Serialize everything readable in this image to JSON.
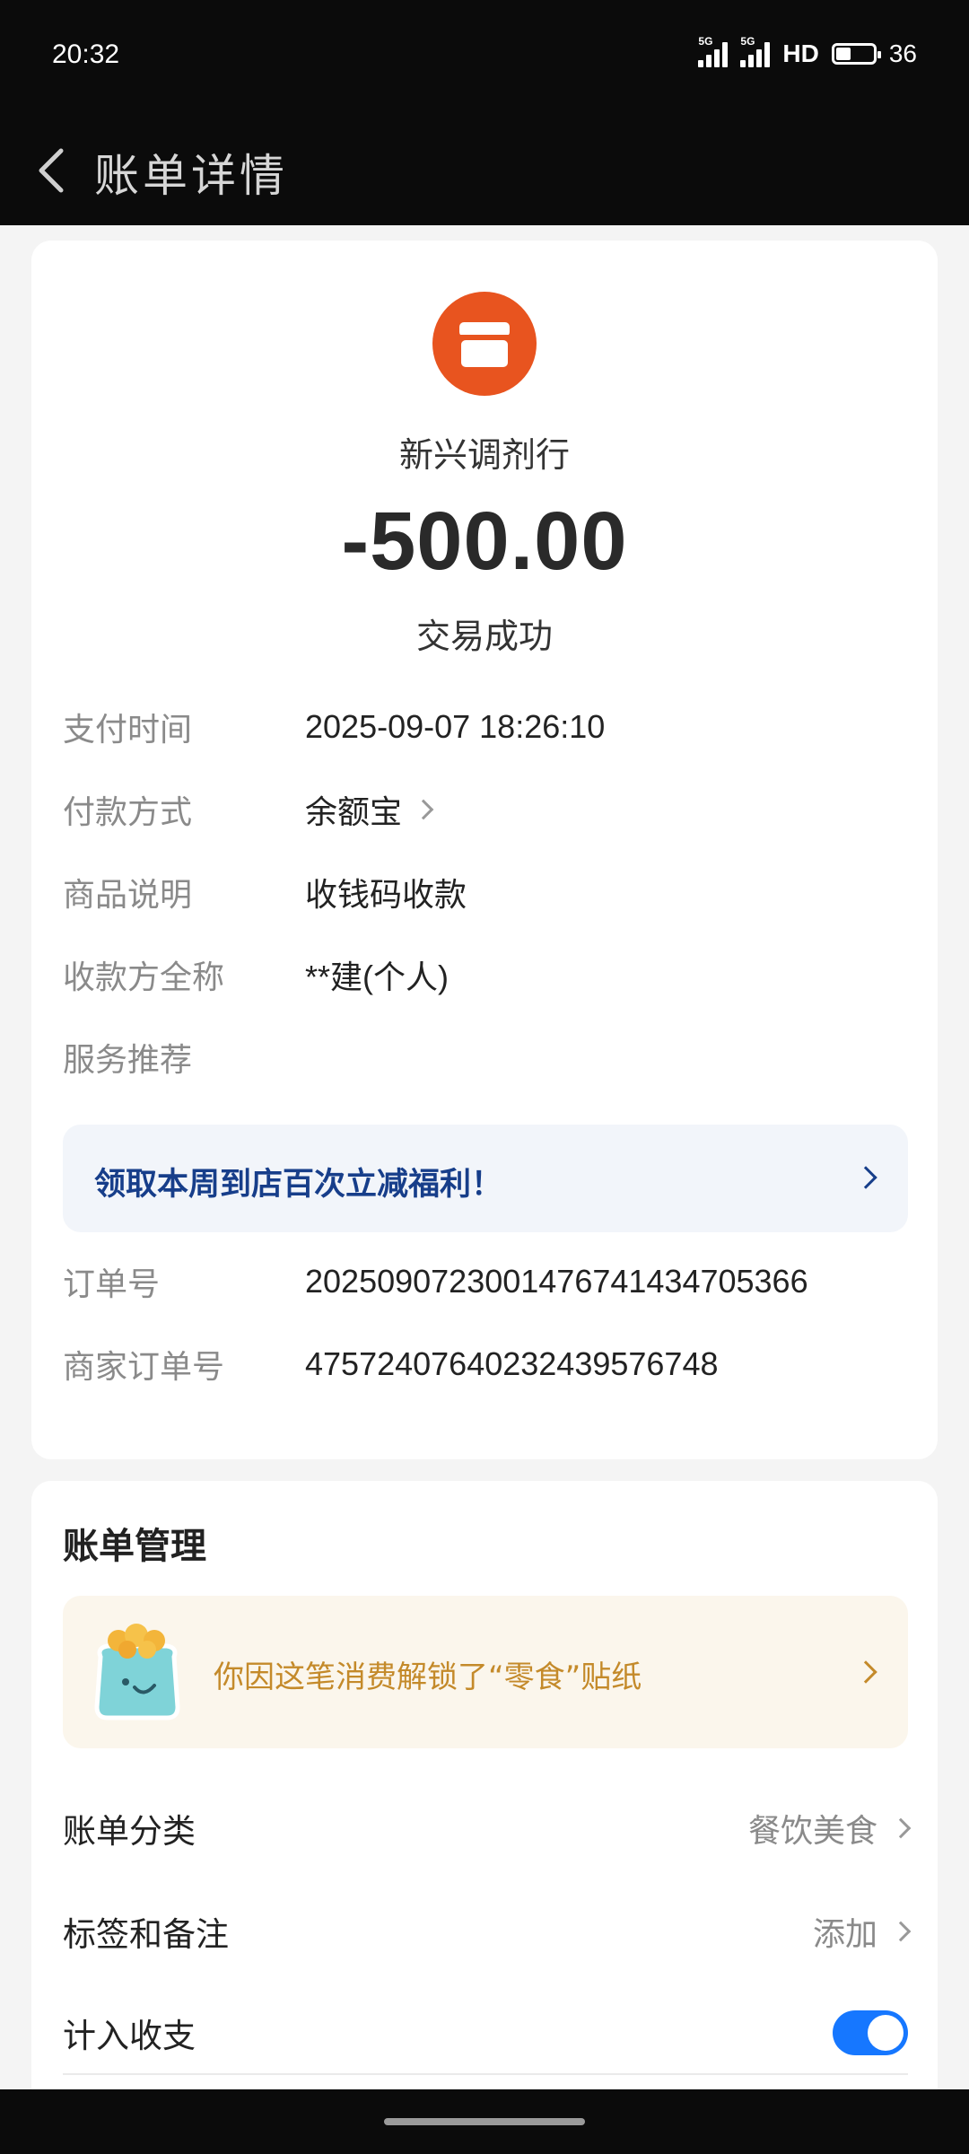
{
  "status_bar": {
    "time": "20:32",
    "network_1": "5G",
    "network_2": "5G",
    "hd_label": "HD",
    "battery_level": 36,
    "battery_text": "36"
  },
  "header": {
    "back_icon": "chevron-left-icon",
    "title": "账单详情"
  },
  "transaction": {
    "merchant_icon": "shop-icon",
    "merchant_icon_color": "#e8541f",
    "merchant_name": "新兴调剂行",
    "amount": "-500.00",
    "status": "交易成功"
  },
  "details": {
    "pay_time_label": "支付时间",
    "pay_time_value": "2025-09-07 18:26:10",
    "pay_method_label": "付款方式",
    "pay_method_value": "余额宝",
    "goods_label": "商品说明",
    "goods_value": "收钱码收款",
    "payee_label": "收款方全称",
    "payee_value": "**建(个人)",
    "service_label": "服务推荐",
    "promo_text": "领取本周到店百次立减福利！",
    "order_no_label": "订单号",
    "order_no_value": "2025090723001476741434705366",
    "merchant_order_label": "商家订单号",
    "merchant_order_value": "4757240764023243957674​8"
  },
  "manage": {
    "title": "账单管理",
    "sticker_icon": "snack-bag-sticker-icon",
    "sticker_text": "你因这笔消费解锁了“零食”贴纸",
    "category_label": "账单分类",
    "category_value": "餐饮美食",
    "tags_label": "标签和备注",
    "tags_value": "添加",
    "include_label": "计入收支",
    "include_on": true
  },
  "colors": {
    "accent_blue": "#1677ff",
    "promo_text": "#173e8a",
    "sticker_text": "#c48a2a"
  }
}
